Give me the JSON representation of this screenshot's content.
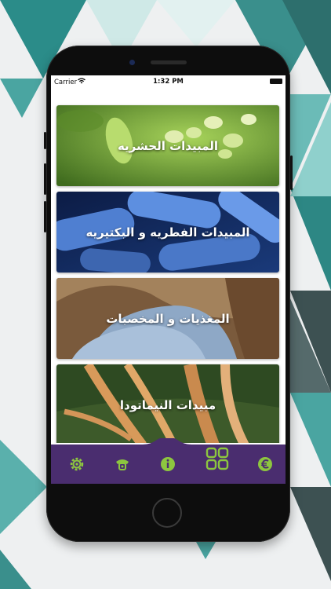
{
  "status_bar": {
    "carrier": "Carrier",
    "time": "1:32 PM"
  },
  "categories": [
    {
      "label": "المبيدات الحشريه"
    },
    {
      "label": "المبيدات الفطريه و البكتيريه"
    },
    {
      "label": "المغذيات و المخصبات"
    },
    {
      "label": "مبيدات النيماتودا"
    }
  ],
  "tab_bar": {
    "icons": [
      "settings-icon",
      "phone-icon",
      "info-icon",
      "grid-icon",
      "currency-icon"
    ]
  },
  "colors": {
    "accent_green": "#8dc63f",
    "tab_bar": "#4a2d6f",
    "background_teal": "#2a8d8a",
    "background_gray": "#3f5556"
  }
}
